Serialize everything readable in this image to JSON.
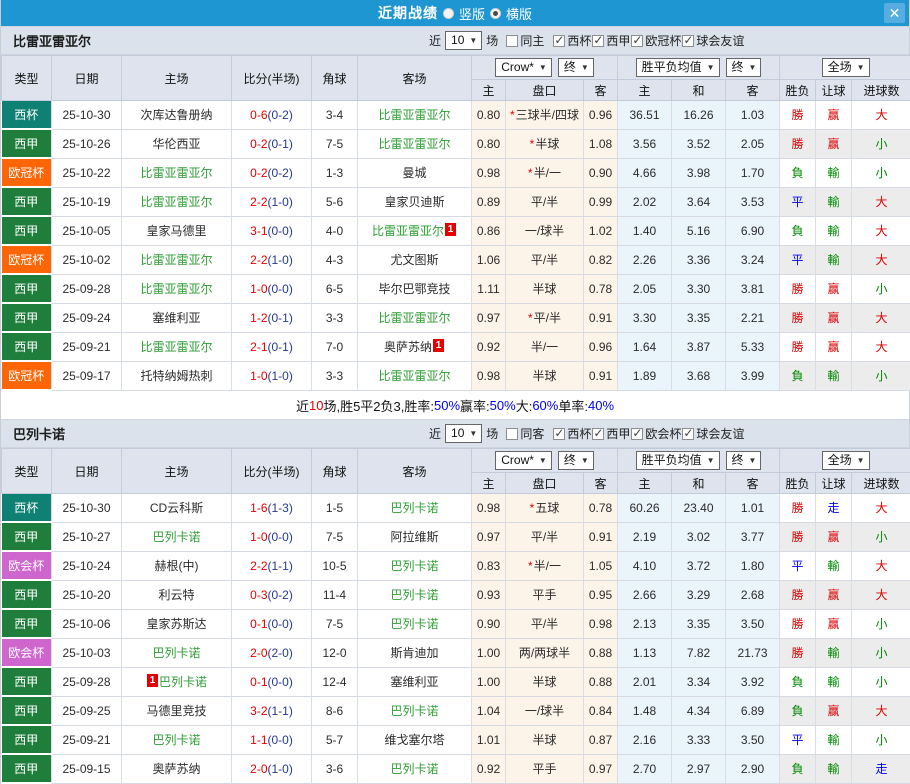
{
  "titlebar": {
    "title": "近期战绩",
    "radio_vertical": "竖版",
    "radio_horizontal": "横版"
  },
  "colors": {
    "topbar_blue": "#1E96D2",
    "close_button_blue": "#57ADE0",
    "section_header_bg": "#DCE2EC",
    "table_header_bg": "#DEE3ED",
    "odds_cell_bg": "#FCF4E9",
    "avg_cell_bg": "#E9F4FB",
    "alt_verdict_bg": "#ECECEC",
    "focus_team_green": "#2E9E33",
    "score_red": "#E60000",
    "half_score_navy": "#233A8F",
    "win_red": "#DD0000",
    "lose_green": "#008800",
    "draw_blue": "#0000EE"
  },
  "type_colors": {
    "cup": "#0E8074",
    "liga": "#1F7E3C",
    "ucl": "#FC6606",
    "uecl": "#CE66CE"
  },
  "table_header": {
    "cols": [
      "类型",
      "日期",
      "主场",
      "比分(半场)",
      "角球",
      "客场"
    ],
    "source": "Crow*",
    "final": "终",
    "avg": "胜平负均值",
    "final2": "终",
    "scope": "全场",
    "subcols": [
      "主",
      "盘口",
      "客",
      "主",
      "和",
      "客",
      "胜负",
      "让球",
      "进球数"
    ]
  },
  "sections": [
    {
      "team": "比雷亚雷亚尔",
      "filter": {
        "near": "近",
        "count": "10",
        "games": "场",
        "options": [
          {
            "label": "同主",
            "checked": false
          },
          {
            "label": "西杯",
            "checked": true
          },
          {
            "label": "西甲",
            "checked": true
          },
          {
            "label": "欧冠杯",
            "checked": true
          },
          {
            "label": "球会友谊",
            "checked": true
          }
        ]
      },
      "rows": [
        {
          "type": "西杯",
          "tk": "cup",
          "date": "25-10-30",
          "home": "次库达鲁册纳",
          "hf": false,
          "hcb": "",
          "hca": "",
          "score": "0-6",
          "half": "(0-2)",
          "corner": "3-4",
          "away": "比雷亚雷亚尔",
          "af": true,
          "aca": "",
          "o": [
            "0.80",
            "三球半/四球",
            "0.96"
          ],
          "star": true,
          "avg": [
            "36.51",
            "16.26",
            "1.03"
          ],
          "v": [
            [
              "勝",
              "r"
            ],
            [
              "赢",
              "r"
            ],
            [
              "大",
              "r"
            ]
          ]
        },
        {
          "type": "西甲",
          "tk": "liga",
          "date": "25-10-26",
          "home": "华伦西亚",
          "hf": false,
          "hcb": "",
          "hca": "",
          "score": "0-2",
          "half": "(0-1)",
          "corner": "7-5",
          "away": "比雷亚雷亚尔",
          "af": true,
          "aca": "",
          "o": [
            "0.80",
            "半球",
            "1.08"
          ],
          "star": true,
          "avg": [
            "3.56",
            "3.52",
            "2.05"
          ],
          "v": [
            [
              "勝",
              "r"
            ],
            [
              "赢",
              "r"
            ],
            [
              "小",
              "g"
            ]
          ]
        },
        {
          "type": "欧冠杯",
          "tk": "ucl",
          "date": "25-10-22",
          "home": "比雷亚雷亚尔",
          "hf": true,
          "hcb": "",
          "hca": "",
          "score": "0-2",
          "half": "(0-2)",
          "corner": "1-3",
          "away": "曼城",
          "af": false,
          "aca": "",
          "o": [
            "0.98",
            "半/一",
            "0.90"
          ],
          "star": true,
          "avg": [
            "4.66",
            "3.98",
            "1.70"
          ],
          "v": [
            [
              "負",
              "g"
            ],
            [
              "輸",
              "g"
            ],
            [
              "小",
              "g"
            ]
          ]
        },
        {
          "type": "西甲",
          "tk": "liga",
          "date": "25-10-19",
          "home": "比雷亚雷亚尔",
          "hf": true,
          "hcb": "",
          "hca": "",
          "score": "2-2",
          "half": "(1-0)",
          "corner": "5-6",
          "away": "皇家贝迪斯",
          "af": false,
          "aca": "",
          "o": [
            "0.89",
            "平/半",
            "0.99"
          ],
          "star": false,
          "avg": [
            "2.02",
            "3.64",
            "3.53"
          ],
          "v": [
            [
              "平",
              "b"
            ],
            [
              "輸",
              "g"
            ],
            [
              "大",
              "r"
            ]
          ]
        },
        {
          "type": "西甲",
          "tk": "liga",
          "date": "25-10-05",
          "home": "皇家马德里",
          "hf": false,
          "hcb": "",
          "hca": "",
          "score": "3-1",
          "half": "(0-0)",
          "corner": "4-0",
          "away": "比雷亚雷亚尔",
          "af": true,
          "aca": "1",
          "o": [
            "0.86",
            "一/球半",
            "1.02"
          ],
          "star": false,
          "avg": [
            "1.40",
            "5.16",
            "6.90"
          ],
          "v": [
            [
              "負",
              "g"
            ],
            [
              "輸",
              "g"
            ],
            [
              "大",
              "r"
            ]
          ]
        },
        {
          "type": "欧冠杯",
          "tk": "ucl",
          "date": "25-10-02",
          "home": "比雷亚雷亚尔",
          "hf": true,
          "hcb": "",
          "hca": "",
          "score": "2-2",
          "half": "(1-0)",
          "corner": "4-3",
          "away": "尤文图斯",
          "af": false,
          "aca": "",
          "o": [
            "1.06",
            "平/半",
            "0.82"
          ],
          "star": false,
          "avg": [
            "2.26",
            "3.36",
            "3.24"
          ],
          "v": [
            [
              "平",
              "b"
            ],
            [
              "輸",
              "g"
            ],
            [
              "大",
              "r"
            ]
          ]
        },
        {
          "type": "西甲",
          "tk": "liga",
          "date": "25-09-28",
          "home": "比雷亚雷亚尔",
          "hf": true,
          "hcb": "",
          "hca": "",
          "score": "1-0",
          "half": "(0-0)",
          "corner": "6-5",
          "away": "毕尔巴鄂竞技",
          "af": false,
          "aca": "",
          "o": [
            "1.11",
            "半球",
            "0.78"
          ],
          "star": false,
          "avg": [
            "2.05",
            "3.30",
            "3.81"
          ],
          "v": [
            [
              "勝",
              "r"
            ],
            [
              "赢",
              "r"
            ],
            [
              "小",
              "g"
            ]
          ]
        },
        {
          "type": "西甲",
          "tk": "liga",
          "date": "25-09-24",
          "home": "塞维利亚",
          "hf": false,
          "hcb": "",
          "hca": "",
          "score": "1-2",
          "half": "(0-1)",
          "corner": "3-3",
          "away": "比雷亚雷亚尔",
          "af": true,
          "aca": "",
          "o": [
            "0.97",
            "平/半",
            "0.91"
          ],
          "star": true,
          "avg": [
            "3.30",
            "3.35",
            "2.21"
          ],
          "v": [
            [
              "勝",
              "r"
            ],
            [
              "赢",
              "r"
            ],
            [
              "大",
              "r"
            ]
          ]
        },
        {
          "type": "西甲",
          "tk": "liga",
          "date": "25-09-21",
          "home": "比雷亚雷亚尔",
          "hf": true,
          "hcb": "",
          "hca": "",
          "score": "2-1",
          "half": "(0-1)",
          "corner": "7-0",
          "away": "奥萨苏纳",
          "af": false,
          "aca": "1",
          "o": [
            "0.92",
            "半/一",
            "0.96"
          ],
          "star": false,
          "avg": [
            "1.64",
            "3.87",
            "5.33"
          ],
          "v": [
            [
              "勝",
              "r"
            ],
            [
              "赢",
              "r"
            ],
            [
              "大",
              "r"
            ]
          ]
        },
        {
          "type": "欧冠杯",
          "tk": "ucl",
          "date": "25-09-17",
          "home": "托特纳姆热刺",
          "hf": false,
          "hcb": "",
          "hca": "",
          "score": "1-0",
          "half": "(1-0)",
          "corner": "3-3",
          "away": "比雷亚雷亚尔",
          "af": true,
          "aca": "",
          "o": [
            "0.98",
            "半球",
            "0.91"
          ],
          "star": false,
          "avg": [
            "1.89",
            "3.68",
            "3.99"
          ],
          "v": [
            [
              "負",
              "g"
            ],
            [
              "輸",
              "g"
            ],
            [
              "小",
              "g"
            ]
          ]
        }
      ],
      "summary": [
        {
          "t": "近"
        },
        {
          "t": "10",
          "c": "red"
        },
        {
          "t": "场,胜5平2负3, "
        },
        {
          "t": "胜率:"
        },
        {
          "t": "50%",
          "c": "blue"
        },
        {
          "t": " 赢率:"
        },
        {
          "t": "50%",
          "c": "blue"
        },
        {
          "t": " 大:"
        },
        {
          "t": "60%",
          "c": "blue"
        },
        {
          "t": " 单率:"
        },
        {
          "t": "40%",
          "c": "blue"
        }
      ]
    },
    {
      "team": "巴列卡诺",
      "filter": {
        "near": "近",
        "count": "10",
        "games": "场",
        "options": [
          {
            "label": "同客",
            "checked": false
          },
          {
            "label": "西杯",
            "checked": true
          },
          {
            "label": "西甲",
            "checked": true
          },
          {
            "label": "欧会杯",
            "checked": true
          },
          {
            "label": "球会友谊",
            "checked": true
          }
        ]
      },
      "rows": [
        {
          "type": "西杯",
          "tk": "cup",
          "date": "25-10-30",
          "home": "CD云科斯",
          "hf": false,
          "hcb": "",
          "hca": "",
          "score": "1-6",
          "half": "(1-3)",
          "corner": "1-5",
          "away": "巴列卡诺",
          "af": true,
          "aca": "",
          "o": [
            "0.98",
            "五球",
            "0.78"
          ],
          "star": true,
          "avg": [
            "60.26",
            "23.40",
            "1.01"
          ],
          "v": [
            [
              "勝",
              "r"
            ],
            [
              "走",
              "b"
            ],
            [
              "大",
              "r"
            ]
          ]
        },
        {
          "type": "西甲",
          "tk": "liga",
          "date": "25-10-27",
          "home": "巴列卡诺",
          "hf": true,
          "hcb": "",
          "hca": "",
          "score": "1-0",
          "half": "(0-0)",
          "corner": "7-5",
          "away": "阿拉维斯",
          "af": false,
          "aca": "",
          "o": [
            "0.97",
            "平/半",
            "0.91"
          ],
          "star": false,
          "avg": [
            "2.19",
            "3.02",
            "3.77"
          ],
          "v": [
            [
              "勝",
              "r"
            ],
            [
              "赢",
              "r"
            ],
            [
              "小",
              "g"
            ]
          ]
        },
        {
          "type": "欧会杯",
          "tk": "uecl",
          "date": "25-10-24",
          "home": "赫根(中)",
          "hf": false,
          "hcb": "",
          "hca": "",
          "score": "2-2",
          "half": "(1-1)",
          "corner": "10-5",
          "away": "巴列卡诺",
          "af": true,
          "aca": "",
          "o": [
            "0.83",
            "半/一",
            "1.05"
          ],
          "star": true,
          "avg": [
            "4.10",
            "3.72",
            "1.80"
          ],
          "v": [
            [
              "平",
              "b"
            ],
            [
              "輸",
              "g"
            ],
            [
              "大",
              "r"
            ]
          ]
        },
        {
          "type": "西甲",
          "tk": "liga",
          "date": "25-10-20",
          "home": "利云特",
          "hf": false,
          "hcb": "",
          "hca": "",
          "score": "0-3",
          "half": "(0-2)",
          "corner": "11-4",
          "away": "巴列卡诺",
          "af": true,
          "aca": "",
          "o": [
            "0.93",
            "平手",
            "0.95"
          ],
          "star": false,
          "avg": [
            "2.66",
            "3.29",
            "2.68"
          ],
          "v": [
            [
              "勝",
              "r"
            ],
            [
              "赢",
              "r"
            ],
            [
              "大",
              "r"
            ]
          ]
        },
        {
          "type": "西甲",
          "tk": "liga",
          "date": "25-10-06",
          "home": "皇家苏斯达",
          "hf": false,
          "hcb": "",
          "hca": "",
          "score": "0-1",
          "half": "(0-0)",
          "corner": "7-5",
          "away": "巴列卡诺",
          "af": true,
          "aca": "",
          "o": [
            "0.90",
            "平/半",
            "0.98"
          ],
          "star": false,
          "avg": [
            "2.13",
            "3.35",
            "3.50"
          ],
          "v": [
            [
              "勝",
              "r"
            ],
            [
              "赢",
              "r"
            ],
            [
              "小",
              "g"
            ]
          ]
        },
        {
          "type": "欧会杯",
          "tk": "uecl",
          "date": "25-10-03",
          "home": "巴列卡诺",
          "hf": true,
          "hcb": "",
          "hca": "",
          "score": "2-0",
          "half": "(2-0)",
          "corner": "12-0",
          "away": "斯肯迪加",
          "af": false,
          "aca": "",
          "o": [
            "1.00",
            "两/两球半",
            "0.88"
          ],
          "star": false,
          "avg": [
            "1.13",
            "7.82",
            "21.73"
          ],
          "v": [
            [
              "勝",
              "r"
            ],
            [
              "輸",
              "g"
            ],
            [
              "小",
              "g"
            ]
          ]
        },
        {
          "type": "西甲",
          "tk": "liga",
          "date": "25-09-28",
          "home": "巴列卡诺",
          "hf": true,
          "hcb": "1",
          "hca": "",
          "score": "0-1",
          "half": "(0-0)",
          "corner": "12-4",
          "away": "塞维利亚",
          "af": false,
          "aca": "",
          "o": [
            "1.00",
            "半球",
            "0.88"
          ],
          "star": false,
          "avg": [
            "2.01",
            "3.34",
            "3.92"
          ],
          "v": [
            [
              "負",
              "g"
            ],
            [
              "輸",
              "g"
            ],
            [
              "小",
              "g"
            ]
          ]
        },
        {
          "type": "西甲",
          "tk": "liga",
          "date": "25-09-25",
          "home": "马德里竞技",
          "hf": false,
          "hcb": "",
          "hca": "",
          "score": "3-2",
          "half": "(1-1)",
          "corner": "8-6",
          "away": "巴列卡诺",
          "af": true,
          "aca": "",
          "o": [
            "1.04",
            "一/球半",
            "0.84"
          ],
          "star": false,
          "avg": [
            "1.48",
            "4.34",
            "6.89"
          ],
          "v": [
            [
              "負",
              "g"
            ],
            [
              "赢",
              "r"
            ],
            [
              "大",
              "r"
            ]
          ]
        },
        {
          "type": "西甲",
          "tk": "liga",
          "date": "25-09-21",
          "home": "巴列卡诺",
          "hf": true,
          "hcb": "",
          "hca": "",
          "score": "1-1",
          "half": "(0-0)",
          "corner": "5-7",
          "away": "维戈塞尔塔",
          "af": false,
          "aca": "",
          "o": [
            "1.01",
            "半球",
            "0.87"
          ],
          "star": false,
          "avg": [
            "2.16",
            "3.33",
            "3.50"
          ],
          "v": [
            [
              "平",
              "b"
            ],
            [
              "輸",
              "g"
            ],
            [
              "小",
              "g"
            ]
          ]
        },
        {
          "type": "西甲",
          "tk": "liga",
          "date": "25-09-15",
          "home": "奥萨苏纳",
          "hf": false,
          "hcb": "",
          "hca": "",
          "score": "2-0",
          "half": "(1-0)",
          "corner": "3-6",
          "away": "巴列卡诺",
          "af": true,
          "aca": "",
          "o": [
            "0.92",
            "平手",
            "0.97"
          ],
          "star": false,
          "avg": [
            "2.70",
            "2.97",
            "2.90"
          ],
          "v": [
            [
              "負",
              "g"
            ],
            [
              "輸",
              "g"
            ],
            [
              "走",
              "b"
            ]
          ]
        }
      ]
    }
  ]
}
